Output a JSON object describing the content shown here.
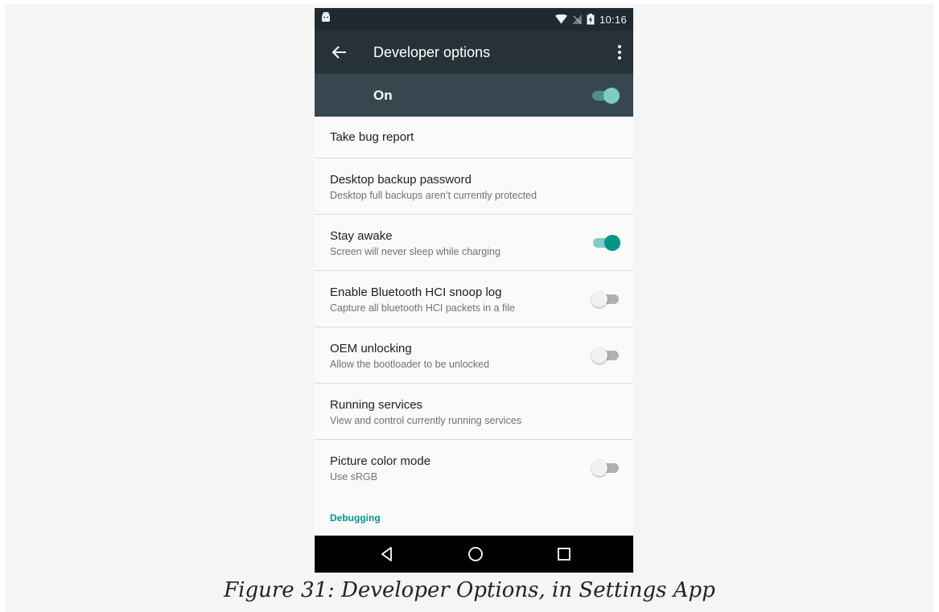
{
  "status_bar": {
    "time": "10:16",
    "icons": [
      "android-icon",
      "wifi-icon",
      "no-signal-icon",
      "battery-charging-icon"
    ]
  },
  "app_bar": {
    "title": "Developer options",
    "back_icon": "arrow-left-icon",
    "menu_icon": "more-vert-icon"
  },
  "master_switch": {
    "label": "On",
    "checked": true
  },
  "settings": [
    {
      "title": "Take bug report",
      "summary": ""
    },
    {
      "title": "Desktop backup password",
      "summary": "Desktop full backups aren’t currently protected"
    },
    {
      "title": "Stay awake",
      "summary": "Screen will never sleep while charging",
      "switch": true
    },
    {
      "title": "Enable Bluetooth HCI snoop log",
      "summary": "Capture all bluetooth HCI packets in a file",
      "switch": false
    },
    {
      "title": "OEM unlocking",
      "summary": "Allow the bootloader to be unlocked",
      "switch": false
    },
    {
      "title": "Running services",
      "summary": "View and control currently running services"
    },
    {
      "title": "Picture color mode",
      "summary": "Use sRGB",
      "switch": false
    }
  ],
  "category": "Debugging",
  "nav_bar": [
    "back-triangle-icon",
    "home-circle-icon",
    "recents-square-icon"
  ],
  "caption": "Figure 31: Developer Options, in Settings App",
  "colors": {
    "status_bar": "#1f2a30",
    "app_bar": "#263238",
    "master_bar": "#37474f",
    "accent": "#009688",
    "accent_light": "#80cbc4"
  }
}
